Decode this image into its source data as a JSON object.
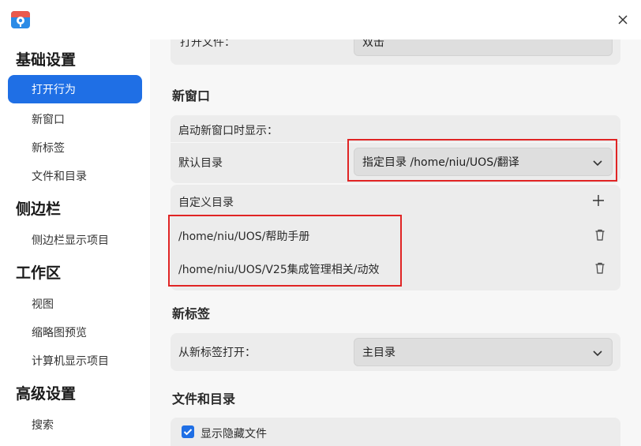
{
  "sidebar": {
    "groups": [
      {
        "title": "基础设置",
        "items": [
          "打开行为",
          "新窗口",
          "新标签",
          "文件和目录"
        ]
      },
      {
        "title": "侧边栏",
        "items": [
          "侧边栏显示项目"
        ]
      },
      {
        "title": "工作区",
        "items": [
          "视图",
          "缩略图预览",
          "计算机显示项目"
        ]
      },
      {
        "title": "高级设置",
        "items": [
          "搜索"
        ]
      }
    ],
    "active_item": "打开行为"
  },
  "main": {
    "partial_top": {
      "label": "打开文件：",
      "value": "双击"
    },
    "new_window": {
      "title": "新窗口",
      "show_label": "启动新窗口时显示：",
      "default_dir_label": "默认目录",
      "default_dir_value": "指定目录 /home/niu/UOS/翻译",
      "custom_dir_label": "自定义目录",
      "custom_dirs": [
        "/home/niu/UOS/帮助手册",
        "/home/niu/UOS/V25集成管理相关/动效"
      ]
    },
    "new_tab": {
      "title": "新标签",
      "open_label": "从新标签打开：",
      "open_value": "主目录"
    },
    "files_dirs": {
      "title": "文件和目录",
      "show_hidden_label": "显示隐藏文件"
    }
  },
  "colors": {
    "accent": "#1f6fe5",
    "highlight": "#e02424"
  }
}
